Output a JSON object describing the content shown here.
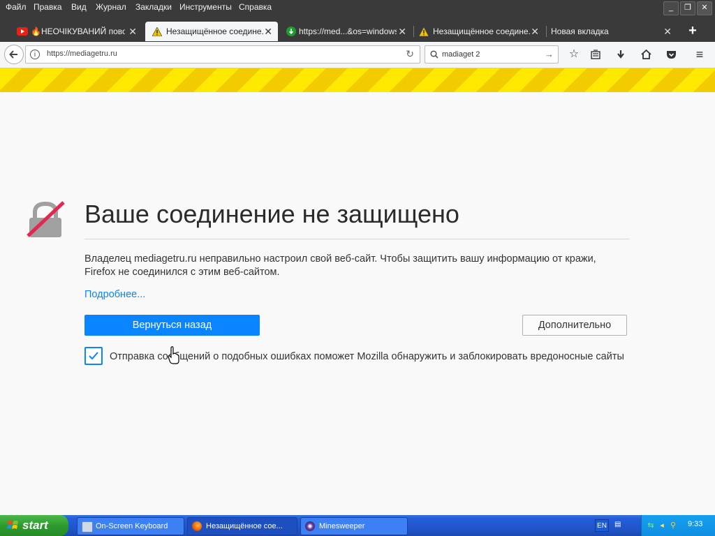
{
  "menubar": {
    "items": [
      "Файл",
      "Правка",
      "Вид",
      "Журнал",
      "Закладки",
      "Инструменты",
      "Справка"
    ]
  },
  "tabs": [
    {
      "label": "🔥НЕОЧІКУВАНИЙ повор...",
      "icon": "youtube-icon"
    },
    {
      "label": "Незащищённое соедине...",
      "icon": "warning-icon",
      "active": true
    },
    {
      "label": "https://med...&os=windows",
      "icon": "mediaget-icon"
    },
    {
      "label": "Незащищённое соедине...",
      "icon": "warning-icon"
    },
    {
      "label": "Новая вкладка",
      "icon": ""
    }
  ],
  "navbar": {
    "url": "https://mediagetru.ru",
    "search_value": "madiaget 2"
  },
  "page": {
    "title": "Ваше соединение не защищено",
    "description": "Владелец mediagetru.ru неправильно настроил свой веб-сайт. Чтобы защитить вашу информацию от кражи, Firefox не соединился с этим веб-сайтом.",
    "learn_more": "Подробнее...",
    "go_back_label": "Вернуться назад",
    "advanced_label": "Дополнительно",
    "report_checked": true,
    "report_text": "Отправка сообщений о подобных ошибках поможет Mozilla обнаружить и заблокировать вредоносные сайты"
  },
  "taskbar": {
    "start_label": "start",
    "tasks": [
      {
        "label": "On-Screen Keyboard",
        "icon": "keyboard-icon"
      },
      {
        "label": "Незащищённое сое...",
        "icon": "firefox-icon",
        "active": true
      },
      {
        "label": "Minesweeper",
        "icon": "minesweeper-icon"
      }
    ],
    "language": "EN",
    "clock": "9:33"
  },
  "colors": {
    "accent": "#0a84ff",
    "stripe_yellow": "#ffe900",
    "chrome_dark": "#3a3a3a"
  }
}
